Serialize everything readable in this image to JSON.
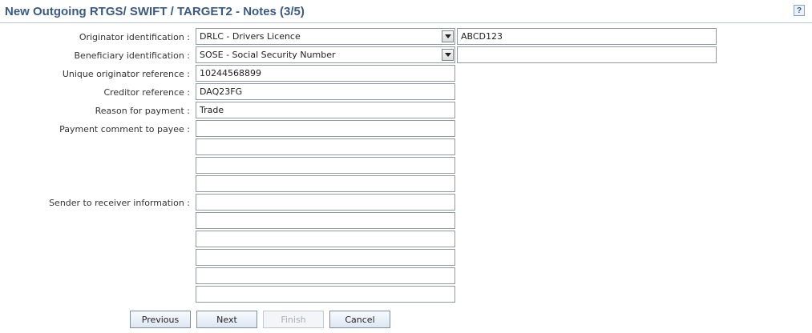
{
  "page": {
    "title": "New Outgoing RTGS/ SWIFT / TARGET2 - Notes (3/5)",
    "help": "?"
  },
  "labels": {
    "originator_id": "Originator identification :",
    "beneficiary_id": "Beneficiary identification :",
    "unique_ref": "Unique originator reference :",
    "creditor_ref": "Creditor reference :",
    "reason": "Reason for payment :",
    "payment_comment": "Payment comment to payee :",
    "sender_info": "Sender to receiver information :"
  },
  "fields": {
    "originator_type": "DRLC - Drivers Licence",
    "originator_value": "ABCD123",
    "beneficiary_type": "SOSE - Social Security Number",
    "beneficiary_value": "",
    "unique_ref": "10244568899",
    "creditor_ref": "DAQ23FG",
    "reason": "Trade",
    "payment_comment": [
      "",
      "",
      "",
      ""
    ],
    "sender_info": [
      "",
      "",
      "",
      "",
      "",
      ""
    ]
  },
  "buttons": {
    "previous": "Previous",
    "next": "Next",
    "finish": "Finish",
    "cancel": "Cancel"
  }
}
